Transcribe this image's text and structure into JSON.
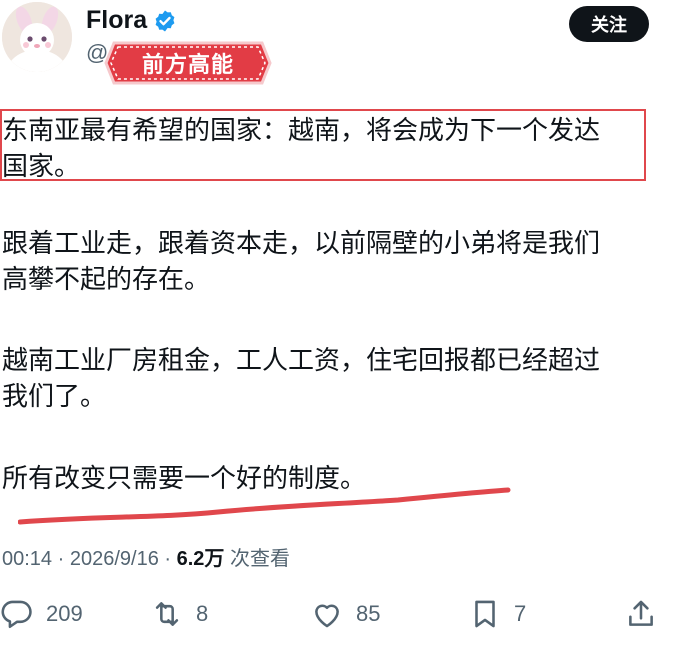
{
  "author": {
    "display_name": "Flora",
    "handle": "@",
    "verified_icon": "verified-badge-icon",
    "follow_label": "关注"
  },
  "overlay_banner": {
    "text": "前方高能"
  },
  "tweet": {
    "p1_line1": "东南亚最有希望的国家：越南，将会成为下一个发达",
    "p1_line2": "国家。",
    "p2_line1": "跟着工业走，跟着资本走，以前隔壁的小弟将是我们",
    "p2_line2": "高攀不起的存在。",
    "p3_line1": "越南工业厂房租金，工人工资，住宅回报都已经超过",
    "p3_line2": "我们了。",
    "p4_line1": "所有改变只需要一个好的制度。"
  },
  "meta": {
    "time": "00:14",
    "sep1": " · ",
    "date": "2026/9/16",
    "sep2": " · ",
    "views_count": "6.2万",
    "views_label": " 次查看"
  },
  "actions": {
    "reply_count": "209",
    "retweet_count": "8",
    "like_count": "85",
    "bookmark_count": "7"
  },
  "colors": {
    "text": "#0f1419",
    "muted": "#536471",
    "verified": "#1d9bf0",
    "highlight_red": "#e0474c",
    "banner_red": "#e23c45"
  }
}
